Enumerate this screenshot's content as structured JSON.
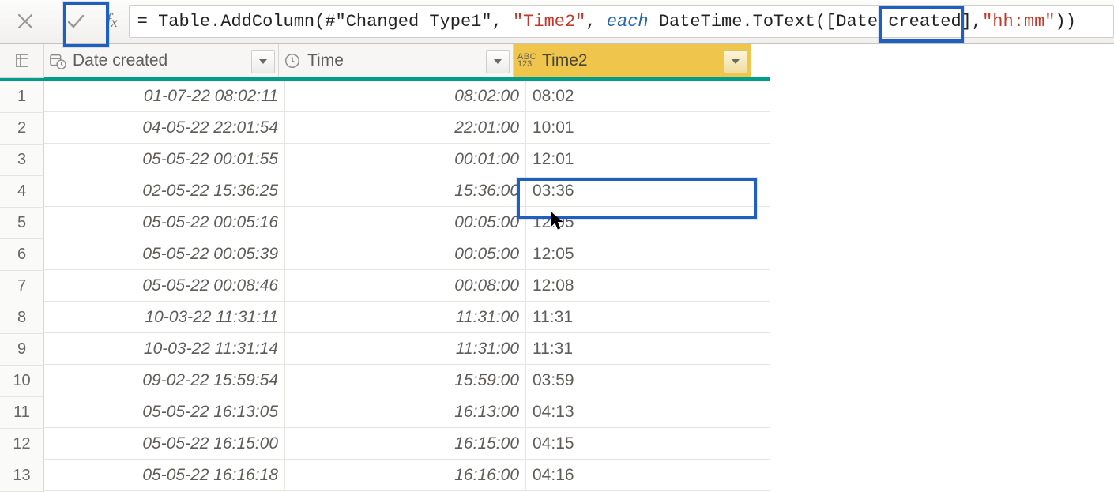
{
  "formula": {
    "prefix": "= ",
    "fn": "Table.AddColumn",
    "args": {
      "step": "#\"Changed Type1\"",
      "newcol": "\"Time2\"",
      "each": "each",
      "expr": "DateTime.ToText([Date created],",
      "fmt": "\"hh:mm\"",
      "close": ")"
    }
  },
  "columns": [
    {
      "key": "c1",
      "label": "Date created",
      "type": "datetime-icon"
    },
    {
      "key": "c2",
      "label": "Time",
      "type": "clock-icon"
    },
    {
      "key": "c3",
      "label": "Time2",
      "type": "abc123-icon"
    }
  ],
  "rows": [
    {
      "n": "1",
      "c1": "01-07-22 08:02:11",
      "c2": "08:02:00",
      "c3": "08:02"
    },
    {
      "n": "2",
      "c1": "04-05-22 22:01:54",
      "c2": "22:01:00",
      "c3": "10:01"
    },
    {
      "n": "3",
      "c1": "05-05-22 00:01:55",
      "c2": "00:01:00",
      "c3": "12:01"
    },
    {
      "n": "4",
      "c1": "02-05-22 15:36:25",
      "c2": "15:36:00",
      "c3": "03:36"
    },
    {
      "n": "5",
      "c1": "05-05-22 00:05:16",
      "c2": "00:05:00",
      "c3": "12:05"
    },
    {
      "n": "6",
      "c1": "05-05-22 00:05:39",
      "c2": "00:05:00",
      "c3": "12:05"
    },
    {
      "n": "7",
      "c1": "05-05-22 00:08:46",
      "c2": "00:08:00",
      "c3": "12:08"
    },
    {
      "n": "8",
      "c1": "10-03-22 11:31:11",
      "c2": "11:31:00",
      "c3": "11:31"
    },
    {
      "n": "9",
      "c1": "10-03-22 11:31:14",
      "c2": "11:31:00",
      "c3": "11:31"
    },
    {
      "n": "10",
      "c1": "09-02-22 15:59:54",
      "c2": "15:59:00",
      "c3": "03:59"
    },
    {
      "n": "11",
      "c1": "05-05-22 16:13:05",
      "c2": "16:13:00",
      "c3": "04:13"
    },
    {
      "n": "12",
      "c1": "05-05-22 16:15:00",
      "c2": "16:15:00",
      "c3": "04:15"
    },
    {
      "n": "13",
      "c1": "05-05-22 16:16:18",
      "c2": "16:16:00",
      "c3": "04:16"
    }
  ]
}
